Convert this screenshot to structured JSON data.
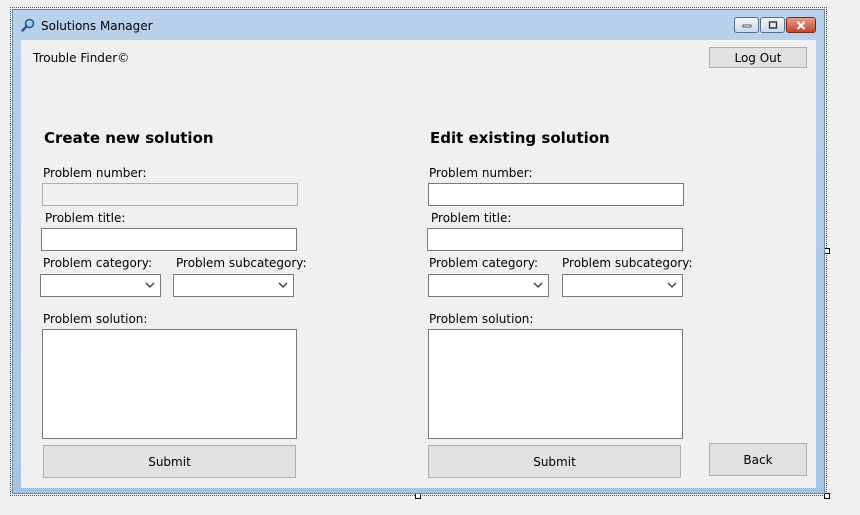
{
  "window": {
    "title": "Solutions Manager",
    "icon": "magnifier-icon"
  },
  "header": {
    "brand": "Trouble Finder©",
    "logout_label": "Log Out"
  },
  "create": {
    "heading": "Create new solution",
    "problem_number_label": "Problem number:",
    "problem_title_label": "Problem title:",
    "category_label": "Problem category:",
    "subcategory_label": "Problem subcategory:",
    "solution_label": "Problem solution:",
    "submit_label": "Submit",
    "problem_number_value": "",
    "problem_title_value": "",
    "category_value": "",
    "subcategory_value": "",
    "solution_value": ""
  },
  "edit": {
    "heading": "Edit existing solution",
    "problem_number_label": "Problem number:",
    "problem_title_label": "Problem title:",
    "category_label": "Problem category:",
    "subcategory_label": "Problem subcategory:",
    "solution_label": "Problem solution:",
    "submit_label": "Submit",
    "problem_number_value": "",
    "problem_title_value": "",
    "category_value": "",
    "subcategory_value": "",
    "solution_value": ""
  },
  "footer": {
    "back_label": "Back"
  }
}
